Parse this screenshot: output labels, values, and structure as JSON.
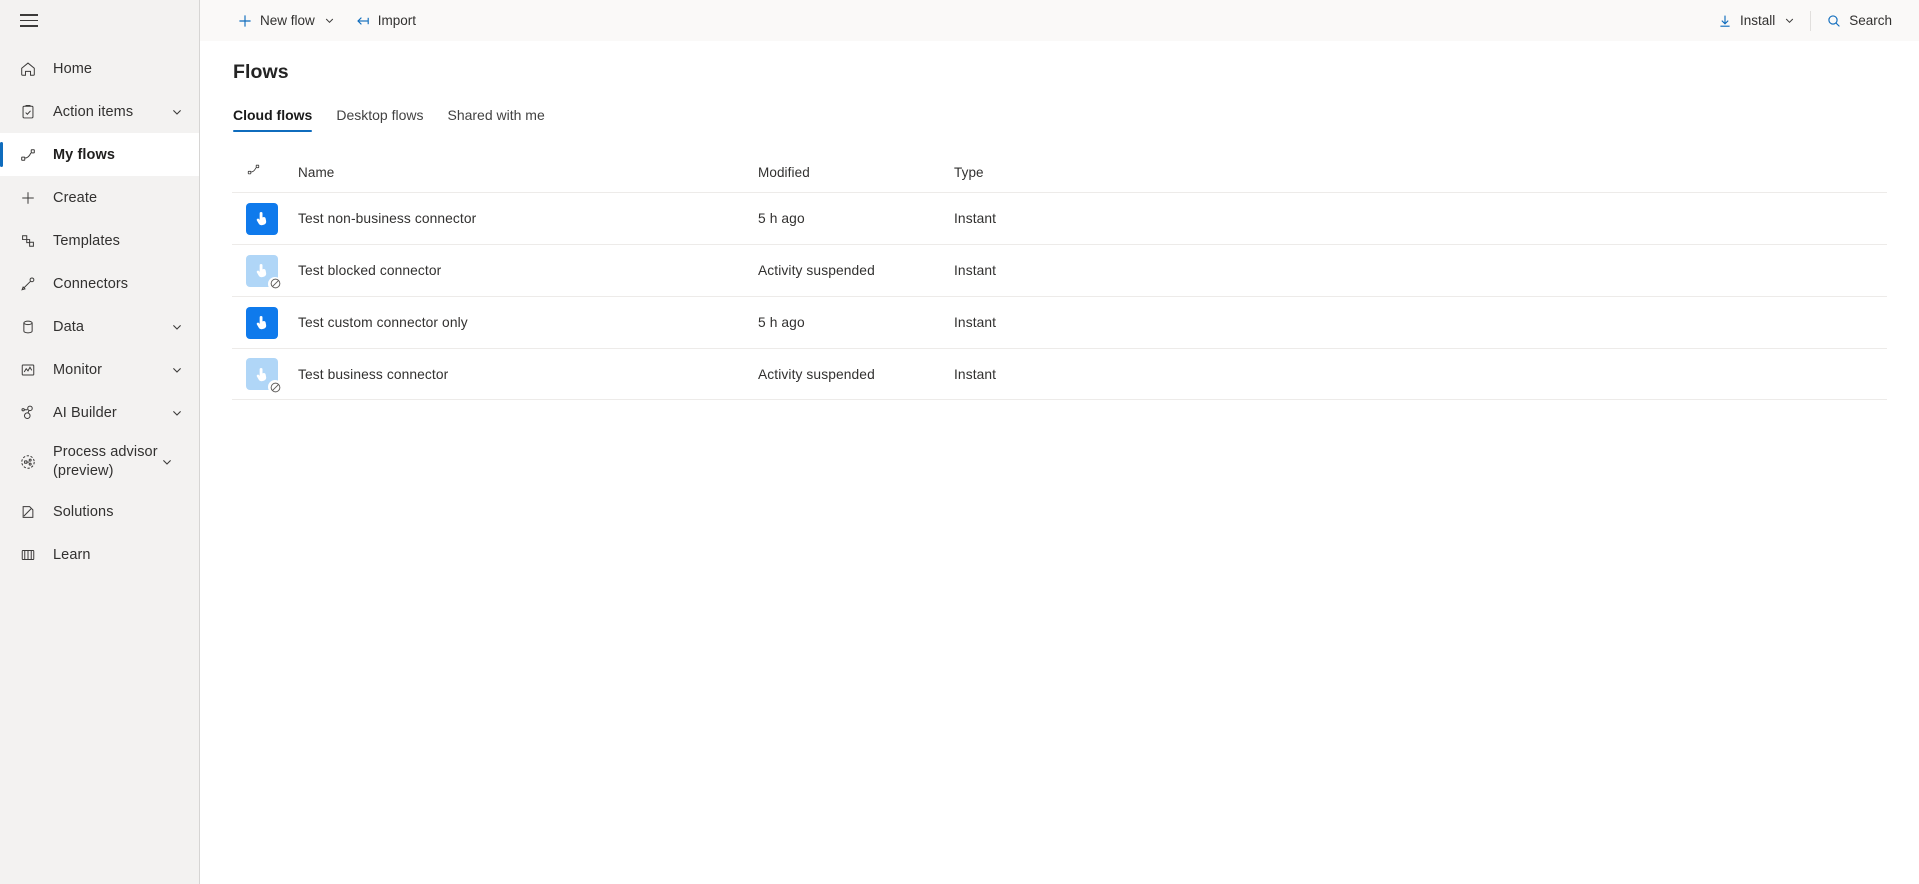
{
  "sidebar": {
    "menu_icon": "hamburger-icon",
    "items": [
      {
        "label": "Home",
        "icon": "home-icon",
        "expandable": false,
        "selected": false
      },
      {
        "label": "Action items",
        "icon": "clipboard-check-icon",
        "expandable": true,
        "selected": false
      },
      {
        "label": "My flows",
        "icon": "flow-icon",
        "expandable": false,
        "selected": true
      },
      {
        "label": "Create",
        "icon": "plus-icon",
        "expandable": false,
        "selected": false
      },
      {
        "label": "Templates",
        "icon": "templates-icon",
        "expandable": false,
        "selected": false
      },
      {
        "label": "Connectors",
        "icon": "connectors-icon",
        "expandable": false,
        "selected": false
      },
      {
        "label": "Data",
        "icon": "database-icon",
        "expandable": true,
        "selected": false
      },
      {
        "label": "Monitor",
        "icon": "monitor-chart-icon",
        "expandable": true,
        "selected": false
      },
      {
        "label": "AI Builder",
        "icon": "ai-builder-icon",
        "expandable": true,
        "selected": false
      },
      {
        "label": "Process advisor (preview)",
        "icon": "process-advisor-icon",
        "expandable": true,
        "selected": false,
        "two_line": true
      },
      {
        "label": "Solutions",
        "icon": "solutions-icon",
        "expandable": false,
        "selected": false
      },
      {
        "label": "Learn",
        "icon": "learn-book-icon",
        "expandable": false,
        "selected": false
      }
    ]
  },
  "commandbar": {
    "new_flow_label": "New flow",
    "new_flow_icon": "plus-icon",
    "new_flow_caret": "chevron-down-icon",
    "import_label": "Import",
    "import_icon": "import-arrow-icon",
    "install_label": "Install",
    "install_icon": "download-arrow-icon",
    "install_caret": "chevron-down-icon",
    "search_label": "Search",
    "search_icon": "search-icon"
  },
  "page": {
    "title": "Flows",
    "tabs": [
      {
        "label": "Cloud flows",
        "active": true
      },
      {
        "label": "Desktop flows",
        "active": false
      },
      {
        "label": "Shared with me",
        "active": false
      }
    ]
  },
  "table": {
    "columns": {
      "icon": "flow-type-icon",
      "name": "Name",
      "modified": "Modified",
      "type": "Type"
    },
    "rows": [
      {
        "name": "Test non-business connector",
        "modified": "5 h ago",
        "type": "Instant",
        "icon": "instant-flow-icon",
        "suspended": false
      },
      {
        "name": "Test blocked connector",
        "modified": "Activity suspended",
        "type": "Instant",
        "icon": "instant-flow-icon",
        "suspended": true
      },
      {
        "name": "Test custom connector only",
        "modified": "5 h ago",
        "type": "Instant",
        "icon": "instant-flow-icon",
        "suspended": false
      },
      {
        "name": "Test business connector",
        "modified": "Activity suspended",
        "type": "Instant",
        "icon": "instant-flow-icon",
        "suspended": true
      }
    ]
  },
  "colors": {
    "accent": "#0f6cbd",
    "icon_tile": "#0f7aec",
    "icon_tile_muted": "#b0d6f7",
    "sidebar_bg": "#f3f2f1",
    "commandbar_bg": "#faf9f8"
  }
}
